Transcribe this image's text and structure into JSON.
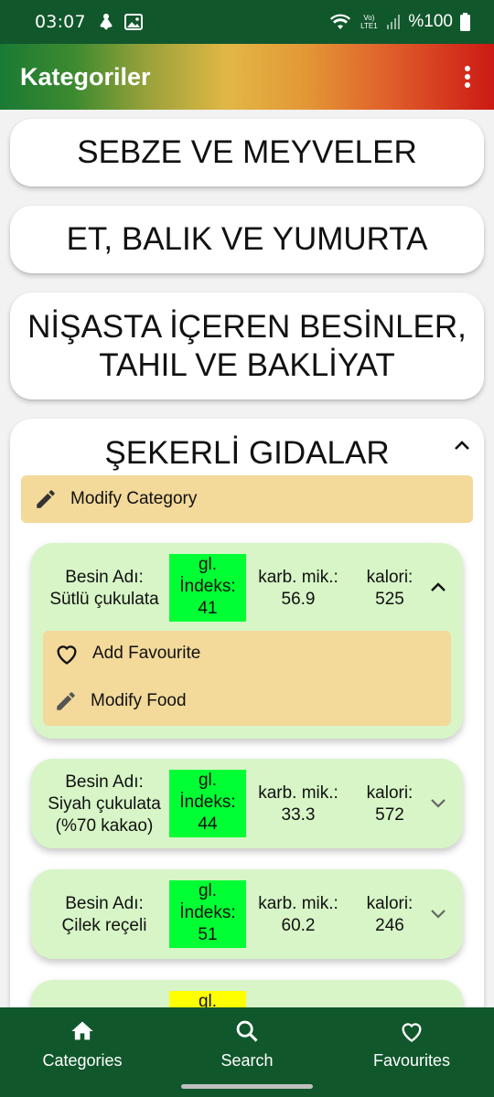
{
  "status_bar": {
    "time": "03:07",
    "network_label": "Vo) LTE1",
    "battery": "%100"
  },
  "app_bar": {
    "title": "Kategoriler"
  },
  "categories": [
    {
      "label": "SEBZE VE MEYVELER"
    },
    {
      "label": "ET, BALIK VE YUMURTA"
    },
    {
      "label_line1": "NİŞASTA İÇEREN BESİNLER,",
      "label_line2": "TAHIL VE BAKLİYAT"
    },
    {
      "label": "ŞEKERLİ GIDALAR"
    }
  ],
  "modify_category_label": "Modify Category",
  "food_labels": {
    "name_prefix": "Besin Adı:",
    "gi_line1": "gl.",
    "gi_line2": "İndeks:",
    "carb": "karb. mik.:",
    "kal": "kalori:"
  },
  "foods": [
    {
      "name": "Sütlü çukulata",
      "gi": "41",
      "carb": "56.9",
      "kal": "525",
      "gi_color": "#00ff33"
    },
    {
      "name_line1": "Siyah çukulata",
      "name_line2": "(%70 kakao)",
      "gi": "44",
      "carb": "33.3",
      "kal": "572",
      "gi_color": "#00ff33"
    },
    {
      "name": "Çilek reçeli",
      "gi": "51",
      "carb": "60.2",
      "kal": "246",
      "gi_color": "#00ff33"
    },
    {
      "gi_color": "#ffff00"
    }
  ],
  "food_actions": {
    "add_favourite": "Add Favourite",
    "modify_food": "Modify Food"
  },
  "bottom_nav": {
    "categories": "Categories",
    "search": "Search",
    "favourites": "Favourites"
  },
  "colors": {
    "status_bar": "#11572c",
    "bottom_nav": "#11572c",
    "food_card": "#d7f5c7",
    "action_panel": "#f3d99a",
    "gi_green": "#00ff33",
    "gi_yellow": "#ffff00"
  }
}
